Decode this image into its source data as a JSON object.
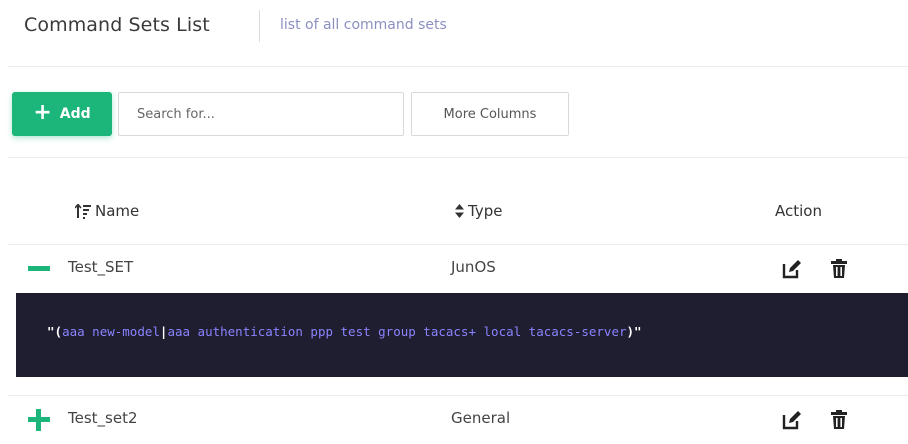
{
  "header": {
    "title": "Command Sets List",
    "subtitle": "list of all command sets"
  },
  "toolbar": {
    "add_label": "Add",
    "search_placeholder": "Search for...",
    "more_columns_label": "More Columns"
  },
  "table": {
    "columns": {
      "name": "Name",
      "type": "Type",
      "action": "Action"
    },
    "rows": [
      {
        "name": "Test_SET",
        "type": "JunOS",
        "expanded": true
      },
      {
        "name": "Test_set2",
        "type": "General",
        "expanded": false
      }
    ]
  },
  "expanded_detail": {
    "open_quote": "\"(",
    "command_1": "aaa new-model",
    "separator": "|",
    "command_2": "aaa authentication ppp test group tacacs+ local tacacs-server",
    "close_quote": ")\""
  },
  "colors": {
    "accent": "#1cb67a",
    "code_bg": "#1f1d30",
    "code_text": "#8a84ff",
    "subtitle": "#8b8fc0"
  },
  "icons": [
    "plus-icon",
    "sort-asc-icon",
    "sort-icon",
    "collapse-icon",
    "expand-icon",
    "edit-icon",
    "trash-icon"
  ]
}
